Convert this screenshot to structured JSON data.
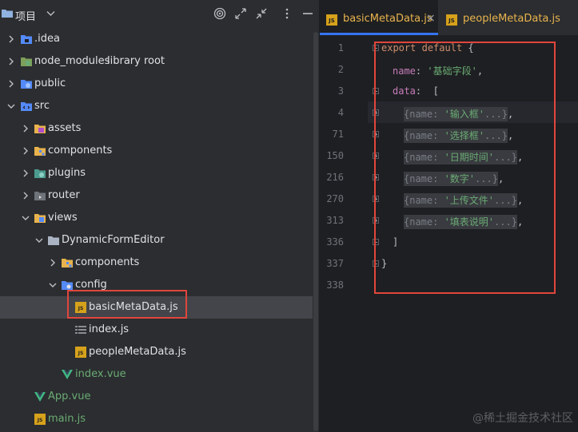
{
  "project": {
    "title": "项目",
    "dropdown_icon": "chevron-down-icon",
    "toolbar": [
      "target-icon",
      "expand-icon",
      "collapse-icon",
      "more-vertical-icon",
      "minimize-icon"
    ]
  },
  "tree": [
    {
      "label": ".idea",
      "icon": "idea-folder-icon"
    },
    {
      "label": "node_modules",
      "hint": "library root",
      "icon": "library-folder-icon"
    },
    {
      "label": "public",
      "icon": "web-folder-icon"
    },
    {
      "label": "src",
      "icon": "source-folder-icon"
    },
    {
      "label": "assets",
      "icon": "assets-folder-icon"
    },
    {
      "label": "components",
      "icon": "components-folder-icon"
    },
    {
      "label": "plugins",
      "icon": "plugins-folder-icon"
    },
    {
      "label": "router",
      "icon": "router-folder-icon"
    },
    {
      "label": "views",
      "icon": "views-folder-icon"
    },
    {
      "label": "DynamicFormEditor",
      "icon": "folder-icon"
    },
    {
      "label": "components",
      "icon": "components-folder-icon"
    },
    {
      "label": "config",
      "icon": "config-folder-icon"
    },
    {
      "label": "basicMetaData.js",
      "icon": "js-file-icon",
      "selected": true
    },
    {
      "label": "index.js",
      "icon": "js-index-file-icon"
    },
    {
      "label": "peopleMetaData.js",
      "icon": "js-file-icon"
    },
    {
      "label": "index.vue",
      "icon": "vue-file-icon"
    },
    {
      "label": "App.vue",
      "icon": "vue-file-icon"
    },
    {
      "label": "main.js",
      "icon": "js-file-icon"
    }
  ],
  "tabs": [
    {
      "label": "basicMetaData.js",
      "badge": "JS",
      "close": "×",
      "active": true
    },
    {
      "label": "peopleMetaData.js",
      "badge": "JS",
      "active": false
    }
  ],
  "code": {
    "line_numbers": [
      "1",
      "2",
      "3",
      "4",
      "71",
      "150",
      "216",
      "270",
      "313",
      "336",
      "337",
      "338"
    ],
    "kw_export": "export",
    "kw_default": "default",
    "open_brace": " {",
    "name_key": "name",
    "colon": ": ",
    "name_value": "'基础字段'",
    "comma": ",",
    "data_key": "data",
    "open_bracket": " [",
    "folded_open": "{name: ",
    "folded_close": "...}",
    "folded_items": [
      "'输入框'",
      "'选择框'",
      "'日期时间'",
      "'数字'",
      "'上传文件'",
      "'填表说明'"
    ],
    "close_bracket": "]",
    "close_brace": "}"
  },
  "watermark": "@稀土掘金技术社区"
}
